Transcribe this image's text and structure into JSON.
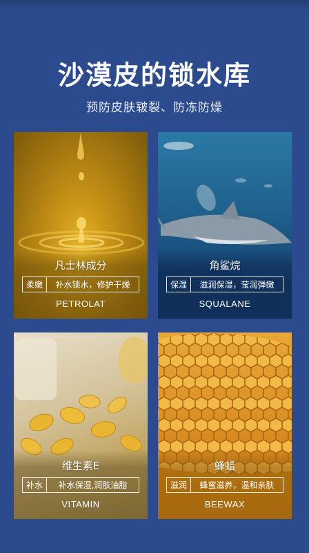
{
  "header": {
    "title": "沙漠皮的锁水库",
    "subtitle": "预防皮肤皲裂、防冻防燥"
  },
  "cards": [
    {
      "name": "凡士林成分",
      "tag_key": "柔嫩",
      "tag_value": "补水锁水，修护干燥",
      "english": "PETROLAT",
      "image": "oil-drop-splash"
    },
    {
      "name": "角鲨烷",
      "tag_key": "保湿",
      "tag_value": "滋润保湿，莹润弹嫩",
      "english": "SQUALANE",
      "image": "shark-underwater"
    },
    {
      "name": "维生素E",
      "tag_key": "补水",
      "tag_value": "补水保湿,润肤油脂",
      "english": "VITAMIN",
      "image": "vitamin-e-capsules"
    },
    {
      "name": "蜂蜡",
      "tag_key": "滋润",
      "tag_value": "蜂蜜滋养，温和亲肤",
      "english": "BEEWAX",
      "image": "honeycomb"
    }
  ],
  "colors": {
    "background": "#2c4b8f",
    "text": "#ffffff"
  }
}
